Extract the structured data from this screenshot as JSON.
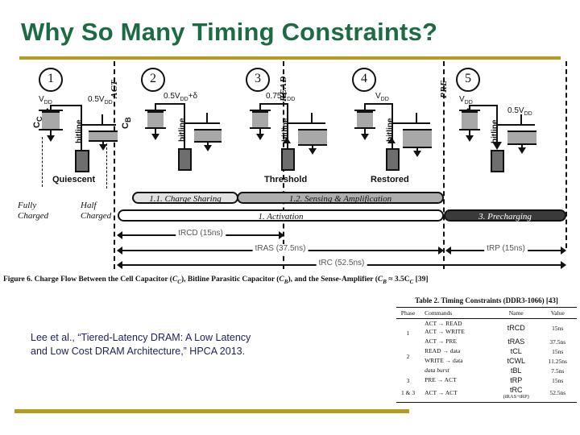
{
  "slide": {
    "title": "Why So Many Timing Constraints?",
    "accent_rule_color": "#b79a20",
    "title_color": "#1c6b42",
    "citation_color": "#1f1f5c"
  },
  "figure": {
    "caption_prefix": "Figure 6. Charge Flow Between the Cell Capacitor (",
    "caption_cc": "C",
    "caption_cc_sub": "C",
    "caption_mid": "), Bitline Parasitic Capacitor (",
    "caption_cb": "C",
    "caption_cb_sub": "B",
    "caption_mid2": "), and the Sense-Amplifier (",
    "caption_rel": "C",
    "caption_rel_sub": "B",
    "caption_rel_tail": " ≈ 3.5C",
    "caption_rel_tail_sub": "C",
    "caption_suffix": " [39]",
    "commands": [
      {
        "label": "ACT"
      },
      {
        "label": "READ"
      },
      {
        "label": "PRE"
      }
    ],
    "stages": [
      {
        "number": "1",
        "state": "Quiescent",
        "vdd": "V",
        "vdd_sub": "DD",
        "bitline": "bitline",
        "bl_voltage": "0.5V",
        "bl_voltage_sub": "DD",
        "cc_label": "C",
        "cc_label_sub": "C",
        "cb_label": "C",
        "cb_label_sub": "B",
        "note_left_line1": "Fully",
        "note_left_line2": "Charged",
        "note_right_line1": "Half",
        "note_right_line2": "Charged"
      },
      {
        "number": "2",
        "state": "",
        "bitline": "bitline",
        "bl_voltage": "0.5V",
        "bl_voltage_sub": "DD",
        "bl_voltage_tail": "+δ"
      },
      {
        "number": "3",
        "state": "Threshold",
        "bitline": "bitline",
        "bl_voltage": "0.75V",
        "bl_voltage_sub": "DD"
      },
      {
        "number": "4",
        "state": "Restored",
        "bitline": "bitline",
        "bl_voltage": "V",
        "bl_voltage_sub": "DD"
      },
      {
        "number": "5",
        "state": "",
        "bitline": "bitline",
        "vdd": "V",
        "vdd_sub": "DD",
        "bl_voltage": "0.5V",
        "bl_voltage_sub": "DD"
      }
    ],
    "phase_bars": [
      {
        "label": "1.1. Charge Sharing",
        "fill": "#e2e2e2"
      },
      {
        "label": "1.2. Sensing & Amplification",
        "fill": "#aeaeae"
      },
      {
        "label": "1. Activation",
        "fill": "#ffffff"
      },
      {
        "label": "3. Precharging",
        "fill": "#3a3a3a"
      }
    ],
    "timings": [
      {
        "label": "tRCD (15ns)"
      },
      {
        "label": "tRAS (37.5ns)"
      },
      {
        "label": "tRP (15ns)"
      },
      {
        "label": "tRC (52.5ns)"
      }
    ]
  },
  "citation": {
    "line1": "Lee et al., “Tiered-Latency DRAM: A Low Latency",
    "line2": "and Low Cost DRAM Architecture,” HPCA 2013."
  },
  "table": {
    "title": "Table 2. Timing Constraints (DDR3-1066) [43]",
    "headers": [
      "Phase",
      "Commands",
      "Name",
      "Value"
    ],
    "rows": [
      {
        "phase": "1",
        "commands": [
          "ACT → READ",
          "ACT → WRITE"
        ],
        "name": "tRCD",
        "sub": "",
        "value": "15ns"
      },
      {
        "phase": "",
        "commands": [
          "ACT → PRE"
        ],
        "name": "tRAS",
        "sub": "",
        "value": "37.5ns"
      },
      {
        "phase": "2",
        "commands": [
          "READ → data",
          "WRITE → data"
        ],
        "name": "tCL",
        "name2": "tCWL",
        "sub": "",
        "value": "15ns",
        "value2": "11.25ns"
      },
      {
        "phase": "",
        "commands": [
          "data burst"
        ],
        "name": "tBL",
        "sub": "",
        "value": "7.5ns"
      },
      {
        "phase": "3",
        "commands": [
          "PRE → ACT"
        ],
        "name": "tRP",
        "sub": "",
        "value": "15ns"
      },
      {
        "phase": "1 & 3",
        "commands": [
          "ACT → ACT"
        ],
        "name": "tRC",
        "sub": "(tRAS+tRP)",
        "value": "52.5ns"
      }
    ]
  }
}
